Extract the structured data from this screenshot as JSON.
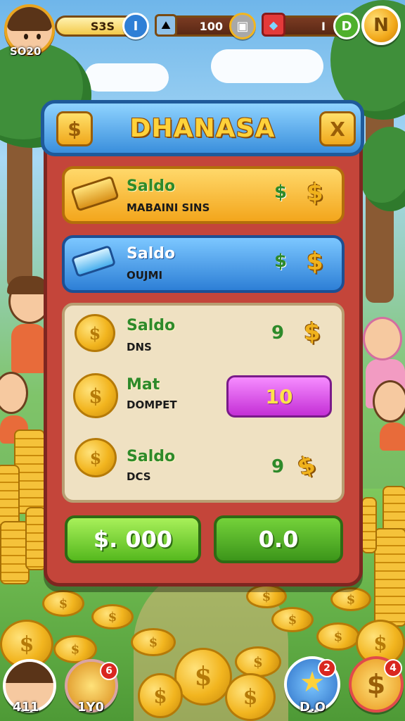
{
  "hud": {
    "avatar_value": "SO20",
    "bar1_value": "S3S",
    "bar1_round_label": "I",
    "bar2_value": "100",
    "bar3_value": "I",
    "bar3_round_label": "D",
    "corner_label": "N"
  },
  "panel": {
    "title": "DHANASA",
    "left_icon": "$",
    "close_icon": "X",
    "rows": [
      {
        "title": "Saldo",
        "subtitle": "MABAINI SINS",
        "symbol": "$",
        "coin_symbol": "$"
      },
      {
        "title": "Saldo",
        "subtitle": "OUJMI",
        "symbol": "$",
        "coin_symbol": "$"
      }
    ],
    "items": [
      {
        "title": "Saldo",
        "subtitle": "DNS",
        "value": "9",
        "coin_symbol": "$"
      },
      {
        "title": "Mat",
        "subtitle": "DOMPET",
        "value": "10"
      },
      {
        "title": "Saldo",
        "subtitle": "DCS",
        "value": "9",
        "coin_symbol": "$"
      }
    ],
    "buttons": {
      "left": "$. 000",
      "right": "0.0"
    }
  },
  "bottom": {
    "left_label": "411",
    "left2_label": "1Y0",
    "left2_badge": "6",
    "star_label": "D.O",
    "star_badge": "2",
    "coin_badge": "4"
  },
  "colors": {
    "panel_red": "#c4453a",
    "header_blue": "#3a8fdc",
    "gold": "#f3a61c",
    "green": "#2e8a2a",
    "pill_purple": "#c42fd6"
  },
  "icons": [
    "coin-icon",
    "gem-icon",
    "chest-icon",
    "star-icon",
    "close-icon",
    "dollar-icon"
  ]
}
